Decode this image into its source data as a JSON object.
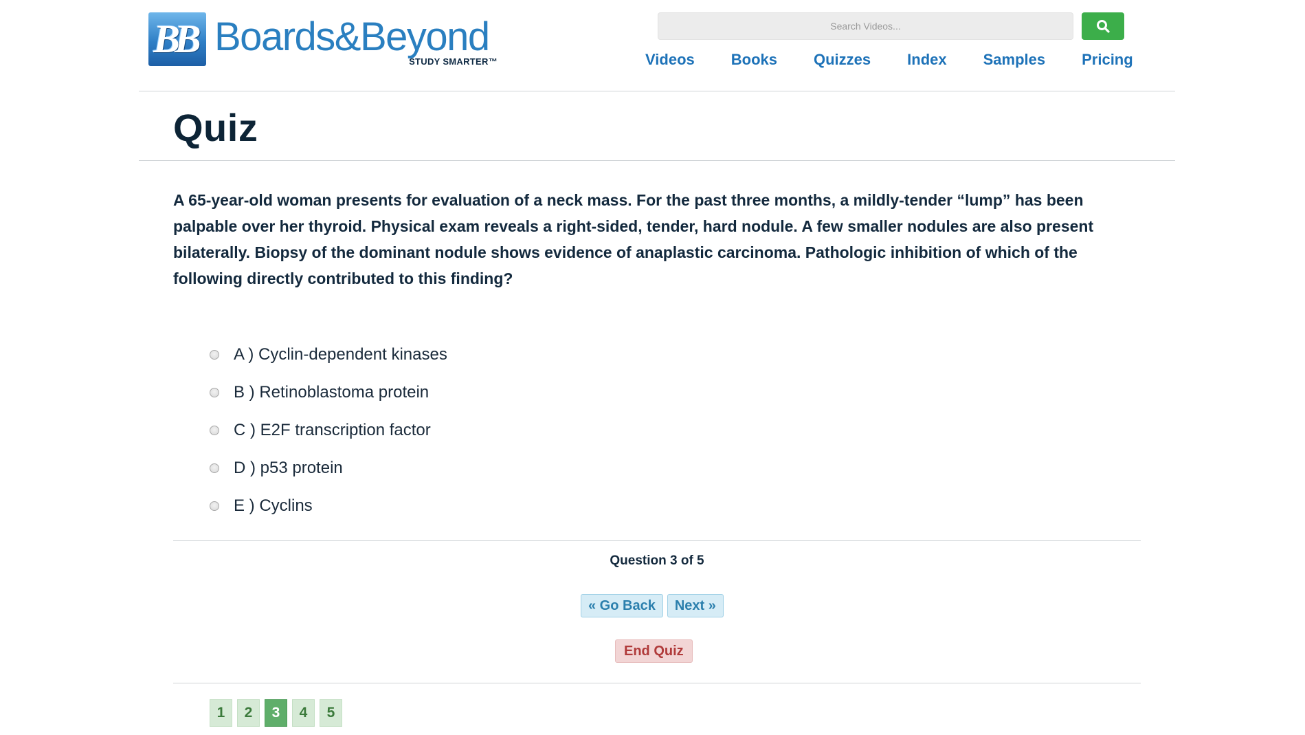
{
  "header": {
    "logo_mark": "BB",
    "logo_word": "Boards&Beyond",
    "logo_tag": "STUDY SMARTER™",
    "search_placeholder": "Search Videos...",
    "nav": [
      "Videos",
      "Books",
      "Quizzes",
      "Index",
      "Samples",
      "Pricing"
    ]
  },
  "page": {
    "title": "Quiz"
  },
  "question": {
    "text": "A 65-year-old woman presents for evaluation of a neck mass. For the past three months, a mildly-tender “lump” has been palpable over her thyroid. Physical exam reveals a right-sided, tender, hard nodule. A few smaller nodules are also present bilaterally. Biopsy of the dominant nodule shows evidence of anaplastic carcinoma. Pathologic inhibition of which of the following directly contributed to this finding?",
    "options": [
      "A ) Cyclin-dependent kinases",
      "B ) Retinoblastoma protein",
      "C ) E2F transcription factor",
      "D ) p53 protein",
      "E ) Cyclins"
    ]
  },
  "progress": {
    "text": "Question 3 of 5",
    "current": 3,
    "total": 5
  },
  "buttons": {
    "back": "« Go Back",
    "next": "Next »",
    "end": "End Quiz"
  },
  "pager": [
    "1",
    "2",
    "3",
    "4",
    "5"
  ],
  "colors": {
    "brand_blue": "#2a7fc0",
    "nav_blue": "#1d72b8",
    "search_green": "#3cae4a",
    "title_dark": "#0d2436",
    "end_red": "#b03a3a",
    "pager_active": "#5fae6a"
  },
  "icons": {
    "search": "search-icon"
  }
}
